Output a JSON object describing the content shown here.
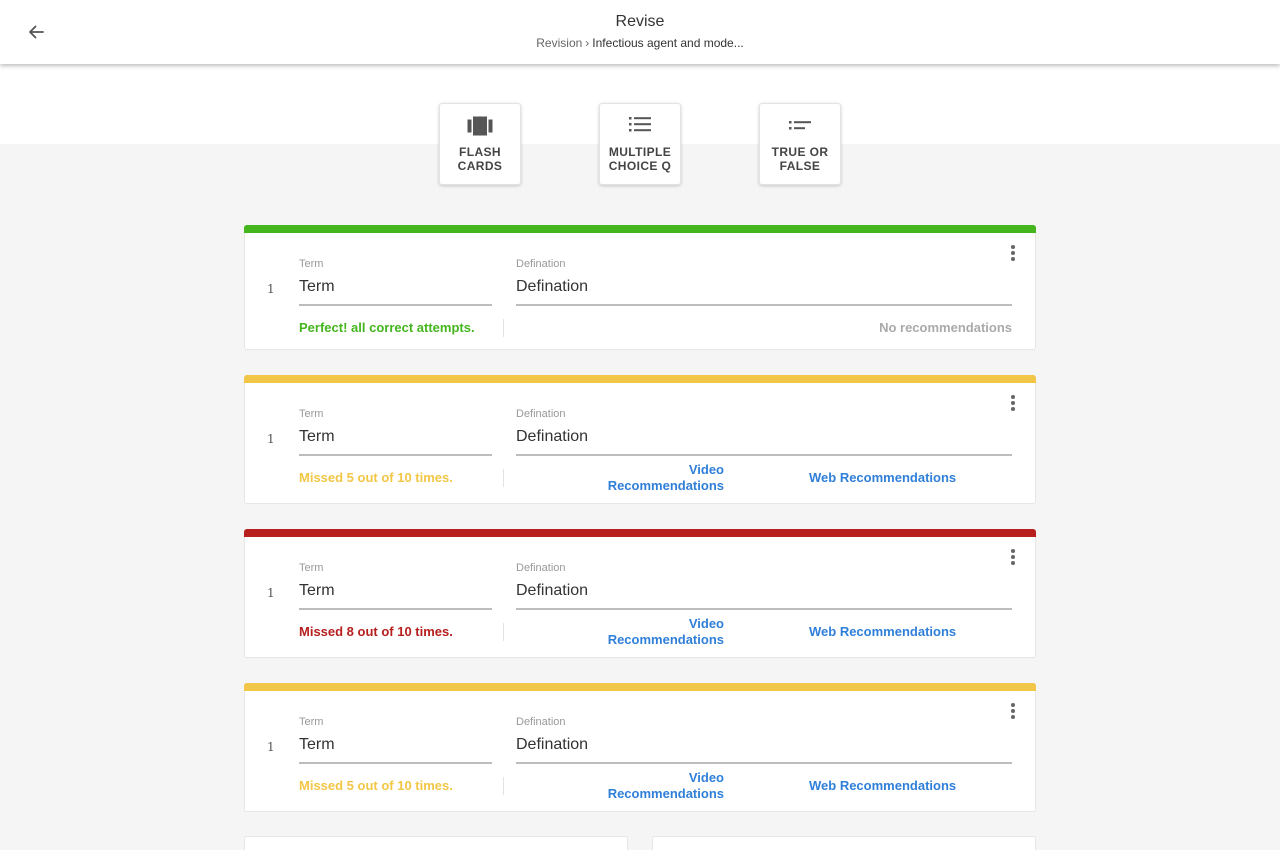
{
  "header": {
    "title": "Revise",
    "breadcrumb": {
      "parent": "Revision",
      "separator": "›",
      "current": "Infectious agent and mode..."
    }
  },
  "modes": [
    {
      "label": "FLASH\nCARDS",
      "icon": "flash-cards-icon"
    },
    {
      "label": "MULTIPLE\nCHOICE Q",
      "icon": "list-icon"
    },
    {
      "label": "TRUE OR\nFALSE",
      "icon": "true-false-icon"
    }
  ],
  "colors": {
    "green": "#45b51e",
    "yellow": "#f2c646",
    "red": "#b71e1e",
    "link": "#2f7fd9"
  },
  "cards": [
    {
      "index": "1",
      "term_label": "Term",
      "term": "Term",
      "definition_label": "Defination",
      "definition": "Defination",
      "status": "Perfect! all correct attempts.",
      "level": "green",
      "no_recommendations": "No recommendations"
    },
    {
      "index": "1",
      "term_label": "Term",
      "term": "Term",
      "definition_label": "Defination",
      "definition": "Defination",
      "status": "Missed 5 out of 10 times.",
      "level": "yellow",
      "video_rec_line1": "Video",
      "video_rec_line2": "Recommendations",
      "web_rec": "Web Recommendations"
    },
    {
      "index": "1",
      "term_label": "Term",
      "term": "Term",
      "definition_label": "Defination",
      "definition": "Defination",
      "status": "Missed 8 out of 10 times.",
      "level": "red",
      "video_rec_line1": "Video",
      "video_rec_line2": "Recommendations",
      "web_rec": "Web Recommendations"
    },
    {
      "index": "1",
      "term_label": "Term",
      "term": "Term",
      "definition_label": "Defination",
      "definition": "Defination",
      "status": "Missed 5 out of 10 times.",
      "level": "yellow",
      "video_rec_line1": "Video",
      "video_rec_line2": "Recommendations",
      "web_rec": "Web Recommendations"
    }
  ]
}
